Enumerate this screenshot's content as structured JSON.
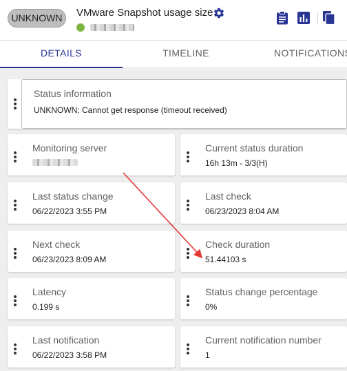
{
  "header": {
    "state": "UNKNOWN",
    "title": "VMware Snapshot usage size",
    "host_status_color": "#7cb342",
    "icons": [
      "gear-icon",
      "clipboard-icon",
      "bar-chart-icon",
      "copy-icon"
    ],
    "accent": "#283593"
  },
  "tabs": [
    {
      "label": "DETAILS"
    },
    {
      "label": "TIMELINE"
    },
    {
      "label": "NOTIFICATIONS"
    }
  ],
  "status": {
    "label": "Status information",
    "value": "UNKNOWN: Cannot get response (timeout received)"
  },
  "cards": {
    "monitoring_server": {
      "label": "Monitoring server"
    },
    "current_status_duration": {
      "label": "Current status duration",
      "value": "16h 13m - 3/3(H)"
    },
    "last_status_change": {
      "label": "Last status change",
      "value": "06/22/2023 3:55 PM"
    },
    "last_check": {
      "label": "Last check",
      "value": "06/23/2023 8:04 AM"
    },
    "next_check": {
      "label": "Next check",
      "value": "06/23/2023 8:09 AM"
    },
    "check_duration": {
      "label": "Check duration",
      "value": "51.44103 s"
    },
    "latency": {
      "label": "Latency",
      "value": "0.199 s"
    },
    "status_change_percentage": {
      "label": "Status change percentage",
      "value": "0%"
    },
    "last_notification": {
      "label": "Last notification",
      "value": "06/22/2023 3:58 PM"
    },
    "current_notification_number": {
      "label": "Current notification number",
      "value": "1"
    }
  }
}
